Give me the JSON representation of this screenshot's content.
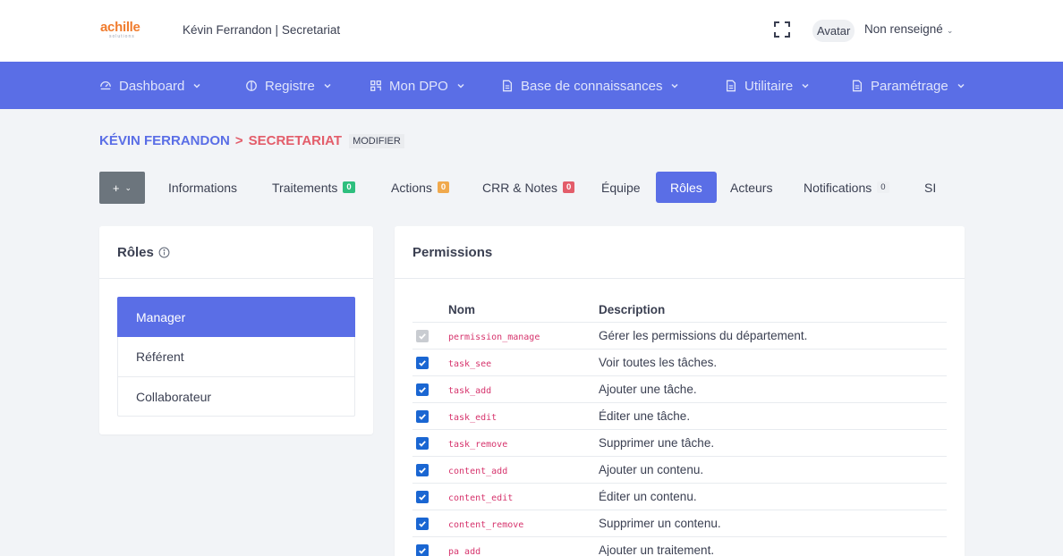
{
  "header": {
    "logo_text": "achille",
    "logo_sub": "solutions",
    "context_title": "Kévin Ferrandon | Secretariat",
    "avatar_label": "Avatar",
    "user_name": "Non renseigné"
  },
  "nav": {
    "items": [
      {
        "label": "Dashboard",
        "icon": "dashboard-icon"
      },
      {
        "label": "Registre",
        "icon": "registry-icon"
      },
      {
        "label": "Mon DPO",
        "icon": "grid-icon"
      },
      {
        "label": "Base de connaissances",
        "icon": "document-icon"
      },
      {
        "label": "Utilitaire",
        "icon": "document-icon"
      },
      {
        "label": "Paramétrage",
        "icon": "document-icon"
      }
    ]
  },
  "breadcrumb": {
    "person": "Kévin Ferrandon",
    "separator": ">",
    "department": "Secretariat",
    "modify_label": "MODIFIER"
  },
  "tabs": {
    "add_label": "+",
    "items": [
      {
        "label": "Informations",
        "badge": null
      },
      {
        "label": "Traitements",
        "badge": "0",
        "badge_color": "#2ebf7e"
      },
      {
        "label": "Actions",
        "badge": "0",
        "badge_color": "#f0a94d"
      },
      {
        "label": "CRR & Notes",
        "badge": "0",
        "badge_color": "#e35d6a"
      },
      {
        "label": "Équipe",
        "badge": null
      },
      {
        "label": "Rôles",
        "badge": null,
        "active": true
      },
      {
        "label": "Acteurs",
        "badge": null
      },
      {
        "label": "Notifications",
        "badge": "0"
      },
      {
        "label": "SI",
        "badge": null
      }
    ]
  },
  "roles": {
    "title": "Rôles",
    "items": [
      "Manager",
      "Référent",
      "Collaborateur"
    ],
    "selected": "Manager"
  },
  "permissions": {
    "title": "Permissions",
    "columns": {
      "name": "Nom",
      "description": "Description"
    },
    "rows": [
      {
        "code": "permission_manage",
        "description": "Gérer les permissions du département.",
        "checked": true,
        "disabled": true
      },
      {
        "code": "task_see",
        "description": "Voir toutes les tâches.",
        "checked": true
      },
      {
        "code": "task_add",
        "description": "Ajouter une tâche.",
        "checked": true
      },
      {
        "code": "task_edit",
        "description": "Éditer une tâche.",
        "checked": true
      },
      {
        "code": "task_remove",
        "description": "Supprimer une tâche.",
        "checked": true
      },
      {
        "code": "content_add",
        "description": "Ajouter un contenu.",
        "checked": true
      },
      {
        "code": "content_edit",
        "description": "Éditer un contenu.",
        "checked": true
      },
      {
        "code": "content_remove",
        "description": "Supprimer un contenu.",
        "checked": true
      },
      {
        "code": "pa_add",
        "description": "Ajouter un traitement.",
        "checked": true
      }
    ]
  },
  "colors": {
    "primary": "#5a6ee6",
    "danger": "#e35d6a",
    "checkbox": "#1a66d2",
    "code": "#d6336c"
  }
}
